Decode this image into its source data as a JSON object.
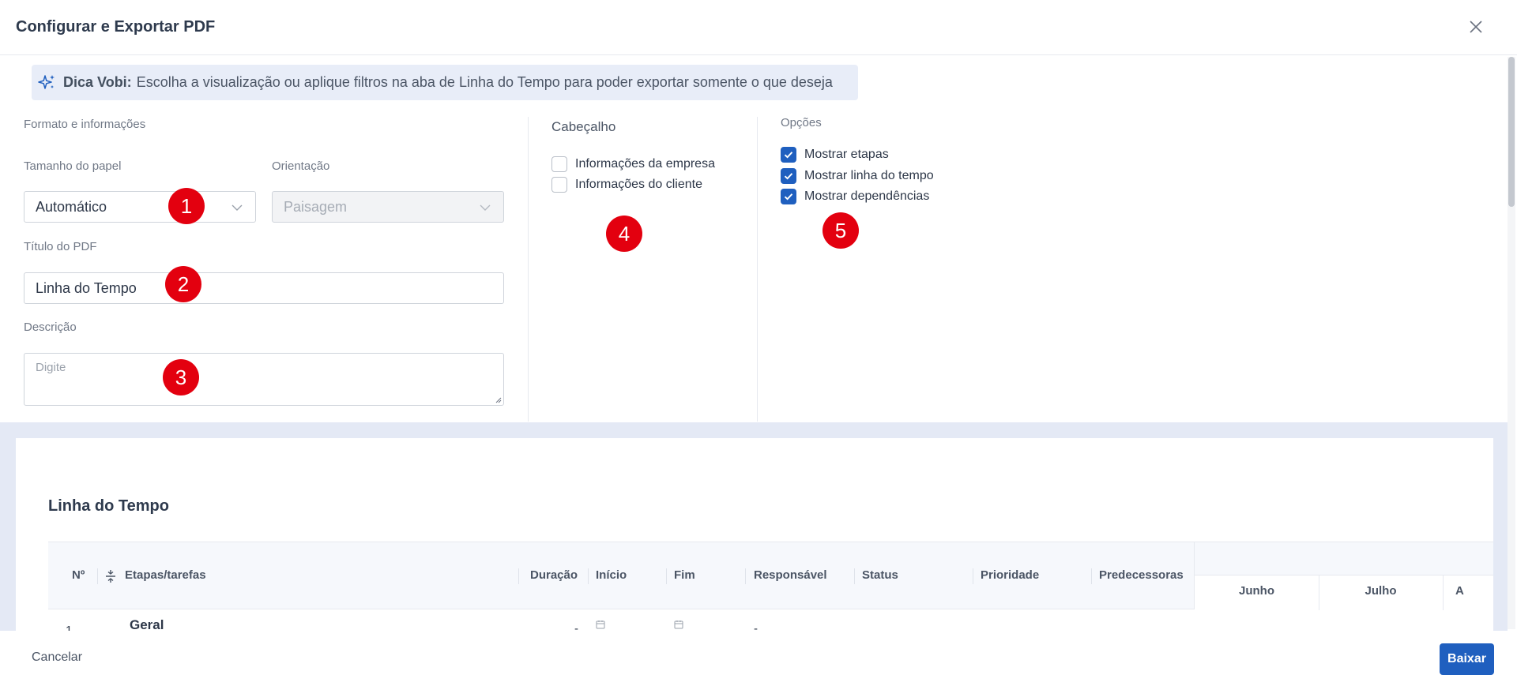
{
  "header": {
    "title": "Configurar e Exportar PDF"
  },
  "tip": {
    "lead": "Dica Vobi:",
    "text": "Escolha a visualização ou aplique filtros na aba de Linha do Tempo para poder exportar somente o que deseja"
  },
  "format": {
    "section_label": "Formato e informações",
    "paper_size_label": "Tamanho do papel",
    "paper_size_value": "Automático",
    "orientation_label": "Orientação",
    "orientation_value": "Paisagem",
    "title_label": "Título do PDF",
    "title_value": "Linha do Tempo",
    "description_label": "Descrição",
    "description_placeholder": "Digite"
  },
  "header_section": {
    "label": "Cabeçalho",
    "options": [
      {
        "label": "Informações da empresa",
        "checked": false
      },
      {
        "label": "Informações do cliente",
        "checked": false
      }
    ]
  },
  "options_section": {
    "label": "Opções",
    "options": [
      {
        "label": "Mostrar etapas",
        "checked": true
      },
      {
        "label": "Mostrar linha do tempo",
        "checked": true
      },
      {
        "label": "Mostrar dependências",
        "checked": true
      }
    ]
  },
  "markers": [
    "1",
    "2",
    "3",
    "4",
    "5"
  ],
  "preview": {
    "title": "Linha do Tempo",
    "columns": [
      "Nº",
      "Etapas/tarefas",
      "Duração",
      "Início",
      "Fim",
      "Responsável",
      "Status",
      "Prioridade",
      "Predecessoras"
    ],
    "months": [
      "Junho",
      "Julho",
      "A"
    ],
    "rows": [
      {
        "num": "1",
        "name": "Geral",
        "duration": "-",
        "responsible": "-"
      }
    ]
  },
  "footer": {
    "cancel_label": "Cancelar",
    "download_label": "Baixar"
  },
  "colors": {
    "primary": "#1f5fbf",
    "marker": "#e3000f",
    "tip_bg": "#e8edf8",
    "preview_bg": "#e4e9f5"
  }
}
